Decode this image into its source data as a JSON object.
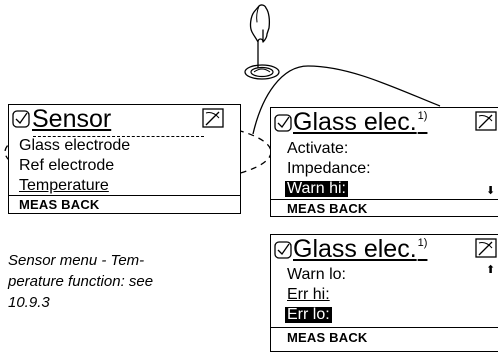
{
  "panel_sensor": {
    "title": "Sensor",
    "items": [
      "Glass electrode",
      "Ref electrode",
      "Temperature"
    ],
    "softkeys": "MEAS BACK"
  },
  "panel_glass_1": {
    "title": "Glass elec.",
    "footnote": "1)",
    "items": [
      "Activate:",
      "Impedance:",
      "Warn hi:"
    ],
    "softkeys": "MEAS BACK",
    "scroll_icon": "down-arrow-icon"
  },
  "panel_glass_2": {
    "title": "Glass elec.",
    "footnote": "1)",
    "items": [
      "Warn lo:",
      "Err hi:",
      "Err lo:"
    ],
    "softkeys": "MEAS BACK",
    "scroll_icon": "up-arrow-icon"
  },
  "caption": "Sensor menu - Temperature function: see 10.9.3",
  "caption_lines": [
    "Sensor menu - Tem-",
    "perature function: see",
    "10.9.3"
  ]
}
